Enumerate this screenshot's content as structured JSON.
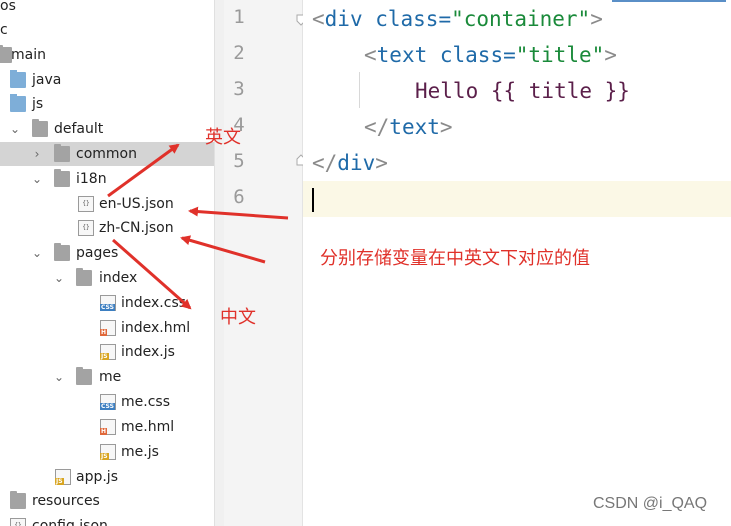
{
  "tree": {
    "rows": [
      {
        "label": "os"
      },
      {
        "label": "c"
      },
      {
        "label": "main"
      },
      {
        "label": "java"
      },
      {
        "label": "js"
      },
      {
        "label": "default"
      },
      {
        "label": "common"
      },
      {
        "label": "i18n"
      },
      {
        "label": "en-US.json"
      },
      {
        "label": "zh-CN.json"
      },
      {
        "label": "pages"
      },
      {
        "label": "index"
      },
      {
        "label": "index.css"
      },
      {
        "label": "index.hml"
      },
      {
        "label": "index.js"
      },
      {
        "label": "me"
      },
      {
        "label": "me.css"
      },
      {
        "label": "me.hml"
      },
      {
        "label": "me.js"
      },
      {
        "label": "app.js"
      },
      {
        "label": "resources"
      },
      {
        "label": "config.json"
      }
    ],
    "icon_tags": {
      "json": "{}",
      "css": "CSS",
      "hml": "H",
      "js": "JS"
    },
    "tag_colors": {
      "css": "#3d7fc1",
      "hml": "#e0683a",
      "js": "#d8a520"
    }
  },
  "editor": {
    "line_numbers": [
      "1",
      "2",
      "3",
      "4",
      "5",
      "6"
    ],
    "lines": {
      "l1": {
        "open": "<",
        "tag": "div",
        "attr": " class",
        "eq": "=",
        "val": "\"container\"",
        "close": ">"
      },
      "l2": {
        "open": "<",
        "tag": "text",
        "attr": " class",
        "eq": "=",
        "val": "\"title\"",
        "close": ">"
      },
      "l3": {
        "text": "Hello {{ title }}"
      },
      "l4": {
        "open": "</",
        "tag": "text",
        "close": ">"
      },
      "l5": {
        "open": "</",
        "tag": "div",
        "close": ">"
      }
    }
  },
  "annotations": {
    "english": "英文",
    "chinese": "中文",
    "note": "分别存储变量在中英文下对应的值",
    "color": "#e0312a"
  },
  "watermark": "CSDN @i_QAQ"
}
